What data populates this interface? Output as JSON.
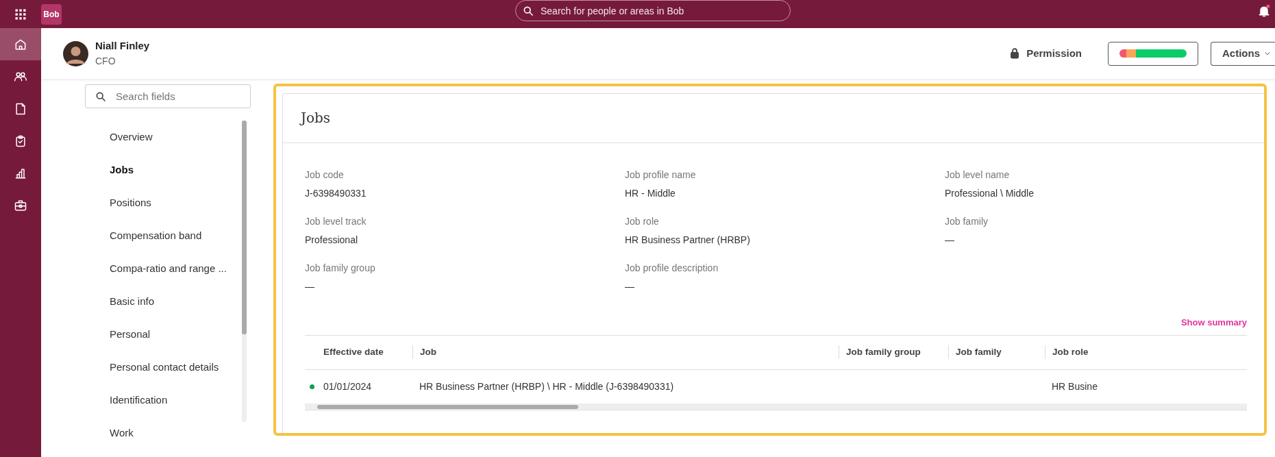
{
  "topbar": {
    "logo": "Bob",
    "search": {
      "placeholder": "Search for people or areas in Bob"
    },
    "notification_dot": true
  },
  "rail": [
    {
      "kind": "home",
      "selected": true
    },
    {
      "kind": "people",
      "selected": false
    },
    {
      "kind": "document",
      "selected": false
    },
    {
      "kind": "clipboard",
      "selected": false
    },
    {
      "kind": "chart",
      "selected": false
    },
    {
      "kind": "briefcase",
      "selected": false
    }
  ],
  "header": {
    "name": "Niall Finley",
    "title": "CFO",
    "permission": "Permission",
    "status_segments": [
      {
        "color": "#f4566e",
        "level": 0.1
      },
      {
        "color": "#fba457",
        "level": 0.15
      },
      {
        "color": "#0ccc6a",
        "level": 0.75
      }
    ],
    "actions": "Actions"
  },
  "fields_nav": {
    "search": {
      "placeholder": "Search fields"
    },
    "items": [
      {
        "label": "Overview",
        "selected": false
      },
      {
        "label": "Jobs",
        "selected": true
      },
      {
        "label": "Positions",
        "selected": false
      },
      {
        "label": "Compensation band",
        "selected": false
      },
      {
        "label": "Compa-ratio and range ...",
        "selected": false
      },
      {
        "label": "Basic info",
        "selected": false
      },
      {
        "label": "Personal",
        "selected": false
      },
      {
        "label": "Personal contact details",
        "selected": false
      },
      {
        "label": "Identification",
        "selected": false
      },
      {
        "label": "Work",
        "selected": false
      }
    ]
  },
  "section": {
    "title": "Jobs",
    "fields": [
      {
        "label": "Job code",
        "value": "J-6398490331"
      },
      {
        "label": "Job profile name",
        "value": "HR - Middle"
      },
      {
        "label": "Job level name",
        "value": "Professional \\ Middle"
      },
      {
        "label": "Job level track",
        "value": "Professional"
      },
      {
        "label": "Job role",
        "value": "HR Business Partner (HRBP)"
      },
      {
        "label": "Job family",
        "value": "—"
      },
      {
        "label": "Job family group",
        "value": "—"
      },
      {
        "label": "Job profile description",
        "value": "—"
      }
    ],
    "show_summary": "Show summary",
    "table": {
      "columns": [
        "Effective date",
        "Job",
        "Job family group",
        "Job family",
        "Job role"
      ],
      "rows": [
        {
          "color": "#1a9a5a",
          "cells": [
            "01/01/2024",
            "HR Business Partner (HRBP) \\ HR - Middle (J-6398490331)",
            "",
            "",
            "HR Busine"
          ]
        }
      ]
    }
  }
}
